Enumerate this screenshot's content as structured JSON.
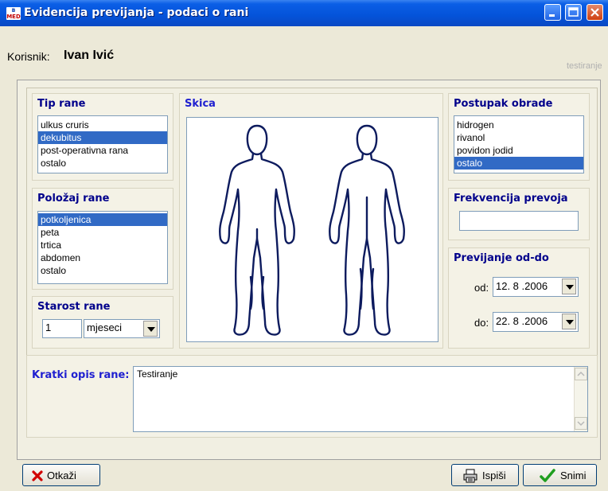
{
  "window": {
    "title": "Evidencija previjanja - podaci o rani",
    "logo_text": "MED"
  },
  "user": {
    "label": "Korisnik:",
    "name": "Ivan Ivić",
    "environment": "testiranje"
  },
  "tip_rane": {
    "title": "Tip rane",
    "items": [
      "ulkus cruris",
      "dekubitus",
      "post-operativna rana",
      "ostalo"
    ],
    "selected": "dekubitus"
  },
  "polozaj_rane": {
    "title": "Položaj rane",
    "items": [
      "potkoljenica",
      "peta",
      "trtica",
      "abdomen",
      "ostalo"
    ],
    "selected": "potkoljenica"
  },
  "starost_rane": {
    "title": "Starost rane",
    "value": "1",
    "unit": "mjeseci"
  },
  "skica": {
    "title": "Skica"
  },
  "postupak_obrade": {
    "title": "Postupak obrade",
    "items": [
      "hidrogen",
      "rivanol",
      "povidon jodid",
      "ostalo"
    ],
    "selected": "ostalo"
  },
  "frekvencija": {
    "title": "Frekvencija prevoja",
    "value": ""
  },
  "previjanje": {
    "title": "Previjanje od-do",
    "od_label": "od:",
    "od_value": "12. 8 .2006",
    "do_label": "do:",
    "do_value": "22. 8 .2006"
  },
  "opis": {
    "label": "Kratki opis rane:",
    "value": "Testiranje"
  },
  "buttons": {
    "cancel": "Otkaži",
    "print": "Ispiši",
    "save": "Snimi"
  },
  "colors": {
    "title_blue": "#00008b",
    "selection": "#316ac5"
  }
}
